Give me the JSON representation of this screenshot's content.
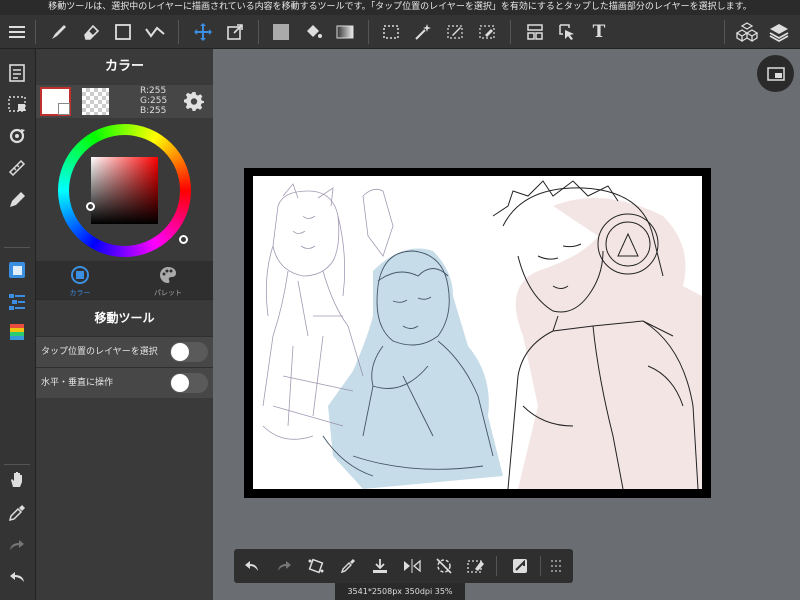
{
  "notice": "移動ツールは、選択中のレイヤーに描画されている内容を移動するツールです。「タップ位置のレイヤーを選択」を有効にするとタップした描画部分のレイヤーを選択します。",
  "colors": {
    "accent": "#3b8ee0",
    "selected_border": "#c0302c",
    "panel_bg": "#3a3a3a",
    "toolbar_bg": "#343434",
    "workspace_bg": "#6a6d72"
  },
  "toolbar": {
    "icons": [
      "menu-icon",
      "brush-icon",
      "eraser-icon",
      "rectangle-icon",
      "correction-icon",
      "move-icon",
      "transform-icon",
      "fill-icon",
      "bucket-icon",
      "gradient-icon",
      "select-rect-icon",
      "magic-wand-icon",
      "select-pen-icon",
      "select-eraser-icon",
      "layout-icon",
      "select-layer-icon",
      "text-icon",
      "materials-icon",
      "layers-icon"
    ],
    "text_tool_label": "T"
  },
  "left_sidebar": {
    "icons": [
      "page-manager-icon",
      "selection-area-icon",
      "rotate-icon",
      "ruler-icon",
      "pen-tip-icon",
      "layer-panel-icon",
      "layer-list-icon",
      "color-bar-icon",
      "hand-icon",
      "eyedropper-icon",
      "redo-icon",
      "undo-icon"
    ]
  },
  "color_panel": {
    "title": "カラー",
    "rgb": {
      "r": "R:255",
      "g": "G:255",
      "b": "B:255"
    },
    "main_color": "#ffffff",
    "tabs": [
      {
        "label": "カラー",
        "active": true
      },
      {
        "label": "パレット",
        "active": false
      }
    ]
  },
  "move_tool": {
    "title": "移動ツール",
    "options": [
      {
        "label": "タップ位置のレイヤーを選択",
        "enabled": false
      },
      {
        "label": "水平・垂直に操作",
        "enabled": false
      }
    ]
  },
  "bottom_toolbar": {
    "icons": [
      "undo-icon",
      "redo-icon",
      "transform-icon",
      "eyedropper-icon",
      "save-icon",
      "flip-icon",
      "rotate-icon",
      "clear-icon",
      "snap-icon",
      "grid-icon"
    ]
  },
  "status": "3541*2508px 350dpi 35%"
}
